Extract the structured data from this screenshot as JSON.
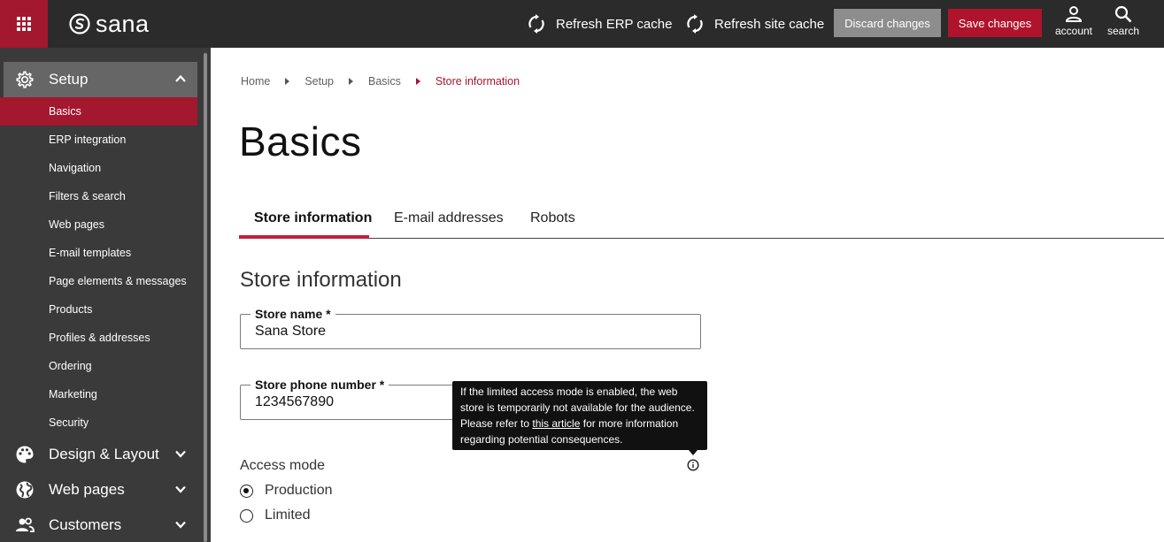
{
  "topbar": {
    "apps_icon": "grid-icon",
    "logo_text": "sana",
    "refresh_erp_label": "Refresh ERP cache",
    "refresh_site_label": "Refresh site cache",
    "discard_label": "Discard changes",
    "save_label": "Save changes",
    "account_label": "account",
    "search_label": "search",
    "colors": {
      "bar": "#2b2b2b",
      "brand": "#a3172f",
      "discard": "#8d8d8d"
    }
  },
  "sidebar": {
    "groups": [
      {
        "label": "Setup",
        "icon": "gear-icon",
        "expanded": true
      },
      {
        "label": "Design & Layout",
        "icon": "palette-icon",
        "expanded": false
      },
      {
        "label": "Web pages",
        "icon": "globe-icon",
        "expanded": false
      },
      {
        "label": "Customers",
        "icon": "users-icon",
        "expanded": false
      }
    ],
    "setup_items": [
      "Basics",
      "ERP integration",
      "Navigation",
      "Filters & search",
      "Web pages",
      "E-mail templates",
      "Page elements & messages",
      "Products",
      "Profiles & addresses",
      "Ordering",
      "Marketing",
      "Security"
    ],
    "active_item": "Basics"
  },
  "breadcrumb": [
    "Home",
    "Setup",
    "Basics",
    "Store information"
  ],
  "page": {
    "title": "Basics",
    "tabs": [
      "Store information",
      "E-mail addresses",
      "Robots"
    ],
    "active_tab": "Store information",
    "section_title": "Store information"
  },
  "form": {
    "store_name": {
      "label": "Store name *",
      "value": "Sana Store"
    },
    "store_phone": {
      "label": "Store phone number *",
      "value": "1234567890"
    },
    "access_mode": {
      "label": "Access mode",
      "options": [
        "Production",
        "Limited"
      ],
      "selected": "Production"
    }
  },
  "tooltip": {
    "line1": "If the limited access mode is enabled, the web",
    "line2": "store is temporarily not available for the audience.",
    "line3_before": "Please refer to ",
    "link_text": "this article",
    "line3_after": " for more information",
    "line4": "regarding potential consequences."
  }
}
